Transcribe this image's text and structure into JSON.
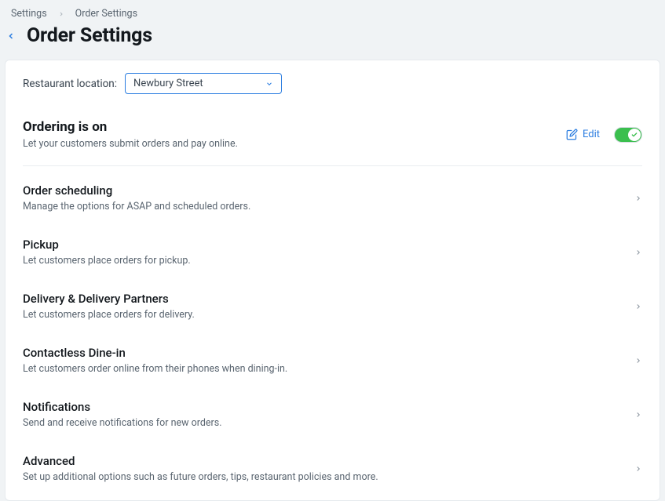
{
  "breadcrumbs": {
    "parent": "Settings",
    "current": "Order Settings"
  },
  "page_title": "Order Settings",
  "location": {
    "label": "Restaurant location:",
    "selected": "Newbury Street"
  },
  "ordering": {
    "title": "Ordering is on",
    "subtitle": "Let your customers submit orders and pay online.",
    "edit_label": "Edit",
    "toggle_on": true
  },
  "sections": [
    {
      "title": "Order scheduling",
      "subtitle": "Manage the options for ASAP and scheduled orders."
    },
    {
      "title": "Pickup",
      "subtitle": "Let customers place orders for pickup."
    },
    {
      "title": "Delivery & Delivery Partners",
      "subtitle": "Let customers place orders for delivery."
    },
    {
      "title": "Contactless Dine-in",
      "subtitle": "Let customers order online from their phones when dining-in."
    },
    {
      "title": "Notifications",
      "subtitle": "Send and receive notifications for new orders."
    },
    {
      "title": "Advanced",
      "subtitle": "Set up additional options such as future orders, tips, restaurant policies and more."
    }
  ]
}
